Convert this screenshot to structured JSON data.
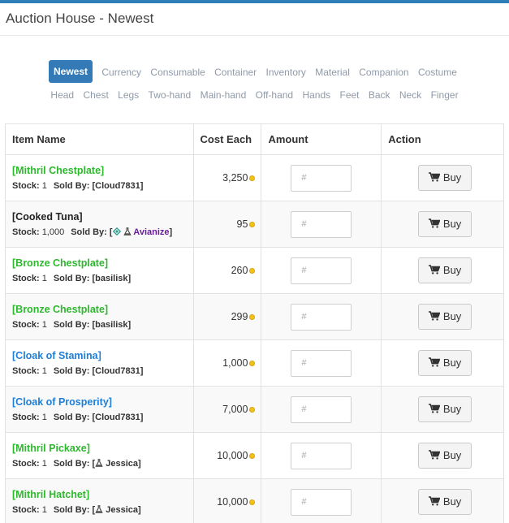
{
  "header": {
    "title": "Auction House - Newest"
  },
  "nav": {
    "row1": [
      "Newest",
      "Currency",
      "Consumable",
      "Container",
      "Inventory",
      "Material",
      "Companion",
      "Costume"
    ],
    "row2": [
      "Head",
      "Chest",
      "Legs",
      "Two-hand",
      "Main-hand",
      "Off-hand",
      "Hands",
      "Feet",
      "Back",
      "Neck",
      "Finger"
    ],
    "active": "Newest"
  },
  "table": {
    "headers": {
      "name": "Item Name",
      "cost": "Cost Each",
      "amount": "Amount",
      "action": "Action"
    },
    "stock_label": "Stock:",
    "sold_by_label": "Sold By:",
    "amount_placeholder": "#",
    "buy_label": "Buy",
    "rows": [
      {
        "name": "[Mithril Chestplate]",
        "color": "#2eb82e",
        "stock": "1",
        "seller": "[Cloud7831]",
        "cost": "3,250"
      },
      {
        "name": "[Cooked Tuna]",
        "color": "#222222",
        "stock": "1,000",
        "seller_prefix": "[",
        "seller_name": "Avianize",
        "seller_suffix": "]",
        "seller_color": "#6a1b9a",
        "cost": "95"
      },
      {
        "name": "[Bronze Chestplate]",
        "color": "#2eb82e",
        "stock": "1",
        "seller": "[basilisk]",
        "cost": "260"
      },
      {
        "name": "[Bronze Chestplate]",
        "color": "#2eb82e",
        "stock": "1",
        "seller": "[basilisk]",
        "cost": "299"
      },
      {
        "name": "[Cloak of Stamina]",
        "color": "#1f7fd6",
        "stock": "1",
        "seller": "[Cloud7831]",
        "cost": "1,000"
      },
      {
        "name": "[Cloak of Prosperity]",
        "color": "#1f7fd6",
        "stock": "1",
        "seller": "[Cloud7831]",
        "cost": "7,000"
      },
      {
        "name": "[Mithril Pickaxe]",
        "color": "#2eb82e",
        "stock": "1",
        "seller_prefix": "[",
        "seller_name": "Jessica",
        "seller_suffix": "]",
        "seller_color": "#333333",
        "cost": "10,000"
      },
      {
        "name": "[Mithril Hatchet]",
        "color": "#2eb82e",
        "stock": "1",
        "seller_prefix": "[",
        "seller_name": "Jessica",
        "seller_suffix": "]",
        "seller_color": "#333333",
        "cost": "10,000"
      }
    ]
  }
}
